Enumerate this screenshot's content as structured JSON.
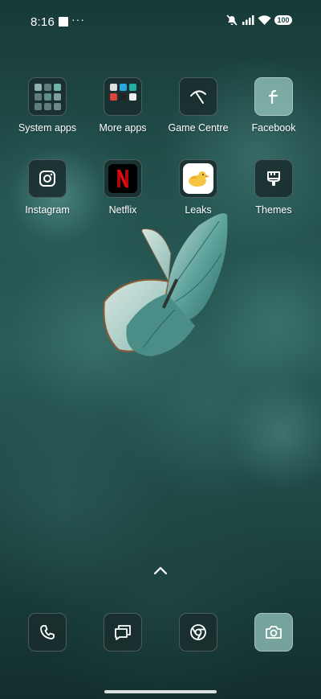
{
  "status_bar": {
    "time": "8:16",
    "dots": "···",
    "battery": "100"
  },
  "apps": {
    "row1": [
      {
        "label": "System apps"
      },
      {
        "label": "More apps"
      },
      {
        "label": "Game Centre"
      },
      {
        "label": "Facebook"
      }
    ],
    "row2": [
      {
        "label": "Instagram"
      },
      {
        "label": "Netflix"
      },
      {
        "label": "Leaks"
      },
      {
        "label": "Themes"
      }
    ]
  },
  "dock": [
    {
      "icon": "phone-icon"
    },
    {
      "icon": "messages-icon"
    },
    {
      "icon": "chrome-icon"
    },
    {
      "icon": "camera-icon"
    }
  ],
  "colors": {
    "accent": "#2a5c58",
    "netflix_red": "#e50914"
  }
}
